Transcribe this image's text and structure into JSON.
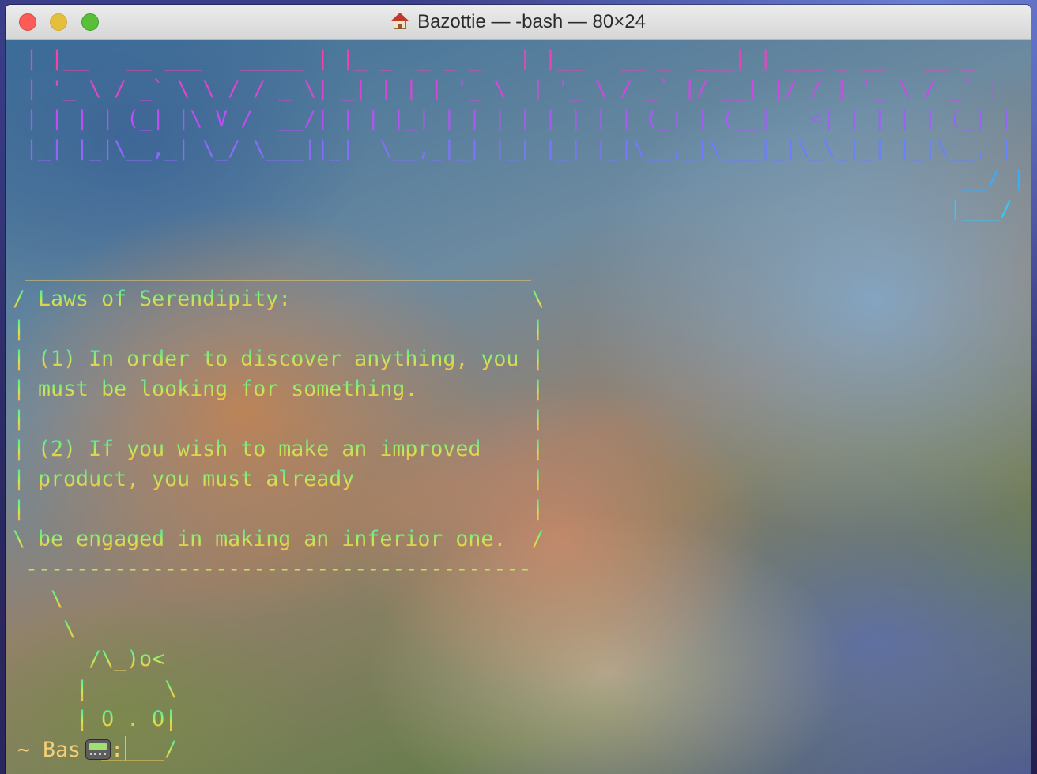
{
  "window": {
    "title": "Bazottie — -bash — 80×24",
    "title_icon": "house-icon",
    "traffic_lights": [
      "close",
      "minimize",
      "zoom"
    ]
  },
  "terminal": {
    "banner_lines": [
      " | |__   __ ___   _____ | |_ _  _ _ _   | |__   __ _  ___| | ___ _ __   __ _",
      " | '_ \\ / _` \\ \\ / / _ \\| _| | | | '_ \\  | '_ \\ / _` |/ __| |/ / | '_ \\ / _` |",
      " | | | | (_| |\\ V /  __/| | | |_| | | | | | | | | (_| | (__|   <| | | | | (_| |",
      " |_| |_|\\__,_| \\_/ \\___||_|  \\__,_|_| |_| |_| |_|\\__,_|\\___|_|\\_\\_|_| |_|\\__, |",
      "                                                                           __/ |",
      "                                                                          |___/"
    ],
    "fortune_lines": [
      " ________________________________________",
      "/ Laws of Serendipity:                   \\",
      "|                                        |",
      "| (1) In order to discover anything, you |",
      "| must be looking for something.         |",
      "|                                        |",
      "| (2) If you wish to make an improved    |",
      "| product, you must already              |",
      "|                                        |",
      "\\ be engaged in making an inferior one.  /",
      " ----------------------------------------",
      "   \\",
      "    \\",
      "      /\\_)o<",
      "     |      \\",
      "     | O . O|",
      "      \\_____/"
    ],
    "prompt": {
      "text": "~ Bas",
      "icon": "pager-icon",
      "suffix": ":"
    }
  }
}
